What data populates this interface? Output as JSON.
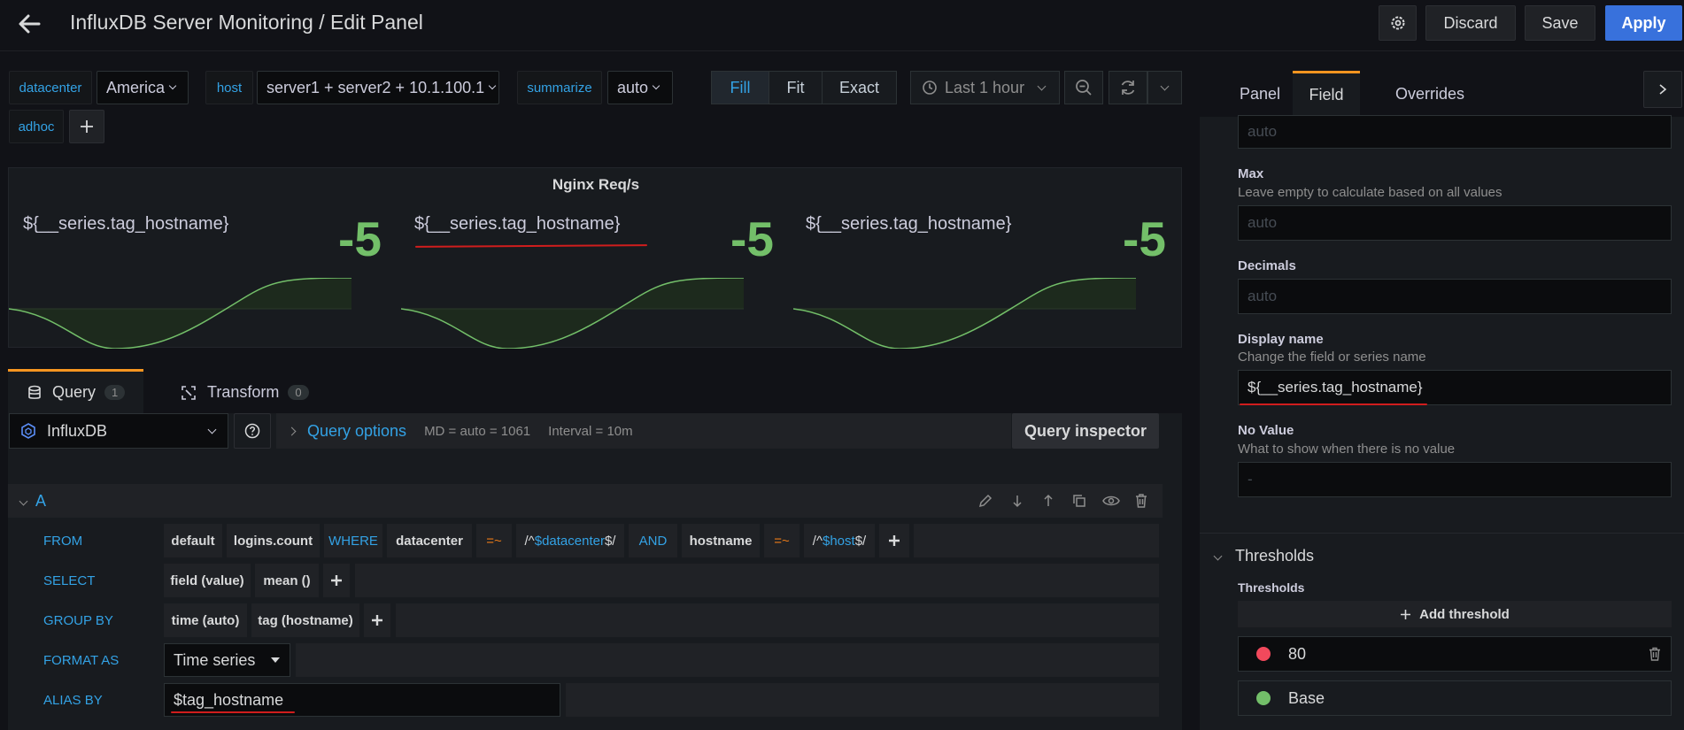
{
  "header": {
    "title": "InfluxDB Server Monitoring / Edit Panel",
    "discard_label": "Discard",
    "save_label": "Save",
    "apply_label": "Apply"
  },
  "variables": {
    "datacenter_label": "datacenter",
    "datacenter_value": "America",
    "host_label": "host",
    "host_value": "server1 + server2 + 10.1.100.1",
    "summarize_label": "summarize",
    "summarize_value": "auto",
    "adhoc_label": "adhoc"
  },
  "view_modes": [
    "Fill",
    "Fit",
    "Exact"
  ],
  "active_view_mode": "Fill",
  "time_range": "Last 1 hour",
  "panel": {
    "title": "Nginx Req/s",
    "stats": [
      {
        "name": "${__series.tag_hostname}",
        "value": "-5"
      },
      {
        "name": "${__series.tag_hostname}",
        "value": "-5"
      },
      {
        "name": "${__series.tag_hostname}",
        "value": "-5"
      }
    ]
  },
  "query_tabs": {
    "query_label": "Query",
    "query_count": "1",
    "transform_label": "Transform",
    "transform_count": "0"
  },
  "datasource": {
    "name": "InfluxDB",
    "query_options_label": "Query options",
    "md_info": "MD = auto = 1061",
    "interval_info": "Interval = 10m",
    "inspector_label": "Query inspector"
  },
  "query": {
    "ref_id": "A",
    "from_label": "FROM",
    "from_db": "default",
    "from_measurement": "logins.count",
    "where_label": "WHERE",
    "where_key1": "datacenter",
    "op1": "=~",
    "where_val1_prefix": "/^",
    "where_val1_var": "$datacenter",
    "where_val1_suffix": "$/",
    "and_label": "AND",
    "where_key2": "hostname",
    "op2": "=~",
    "where_val2_prefix": "/^",
    "where_val2_var": "$host",
    "where_val2_suffix": "$/",
    "select_label": "SELECT",
    "select_field": "field (value)",
    "select_fn": "mean ()",
    "groupby_label": "GROUP BY",
    "groupby_time": "time (auto)",
    "groupby_tag": "tag (hostname)",
    "format_label": "FORMAT AS",
    "format_value": "Time series",
    "alias_label": "ALIAS BY",
    "alias_value": "$tag_hostname"
  },
  "options_tabs": {
    "panel": "Panel",
    "field": "Field",
    "overrides": "Overrides",
    "active": "Field"
  },
  "field_options": {
    "min_placeholder": "auto",
    "max_title": "Max",
    "max_desc": "Leave empty to calculate based on all values",
    "max_placeholder": "auto",
    "decimals_title": "Decimals",
    "decimals_placeholder": "auto",
    "display_name_title": "Display name",
    "display_name_desc": "Change the field or series name",
    "display_name_value": "${__series.tag_hostname}",
    "no_value_title": "No Value",
    "no_value_desc": "What to show when there is no value",
    "no_value_placeholder": "-"
  },
  "thresholds": {
    "section_title": "Thresholds",
    "label": "Thresholds",
    "add_label": "Add threshold",
    "items": [
      {
        "value": "80",
        "color": "#f2495c"
      },
      {
        "value": "Base",
        "color": "#73bf69"
      }
    ]
  },
  "colors": {
    "accent_blue": "#33a2e5",
    "stat_green": "#73bf69",
    "apply_blue": "#3871dc",
    "annotation_red": "#d01d1d",
    "tab_orange": "#f79520"
  }
}
